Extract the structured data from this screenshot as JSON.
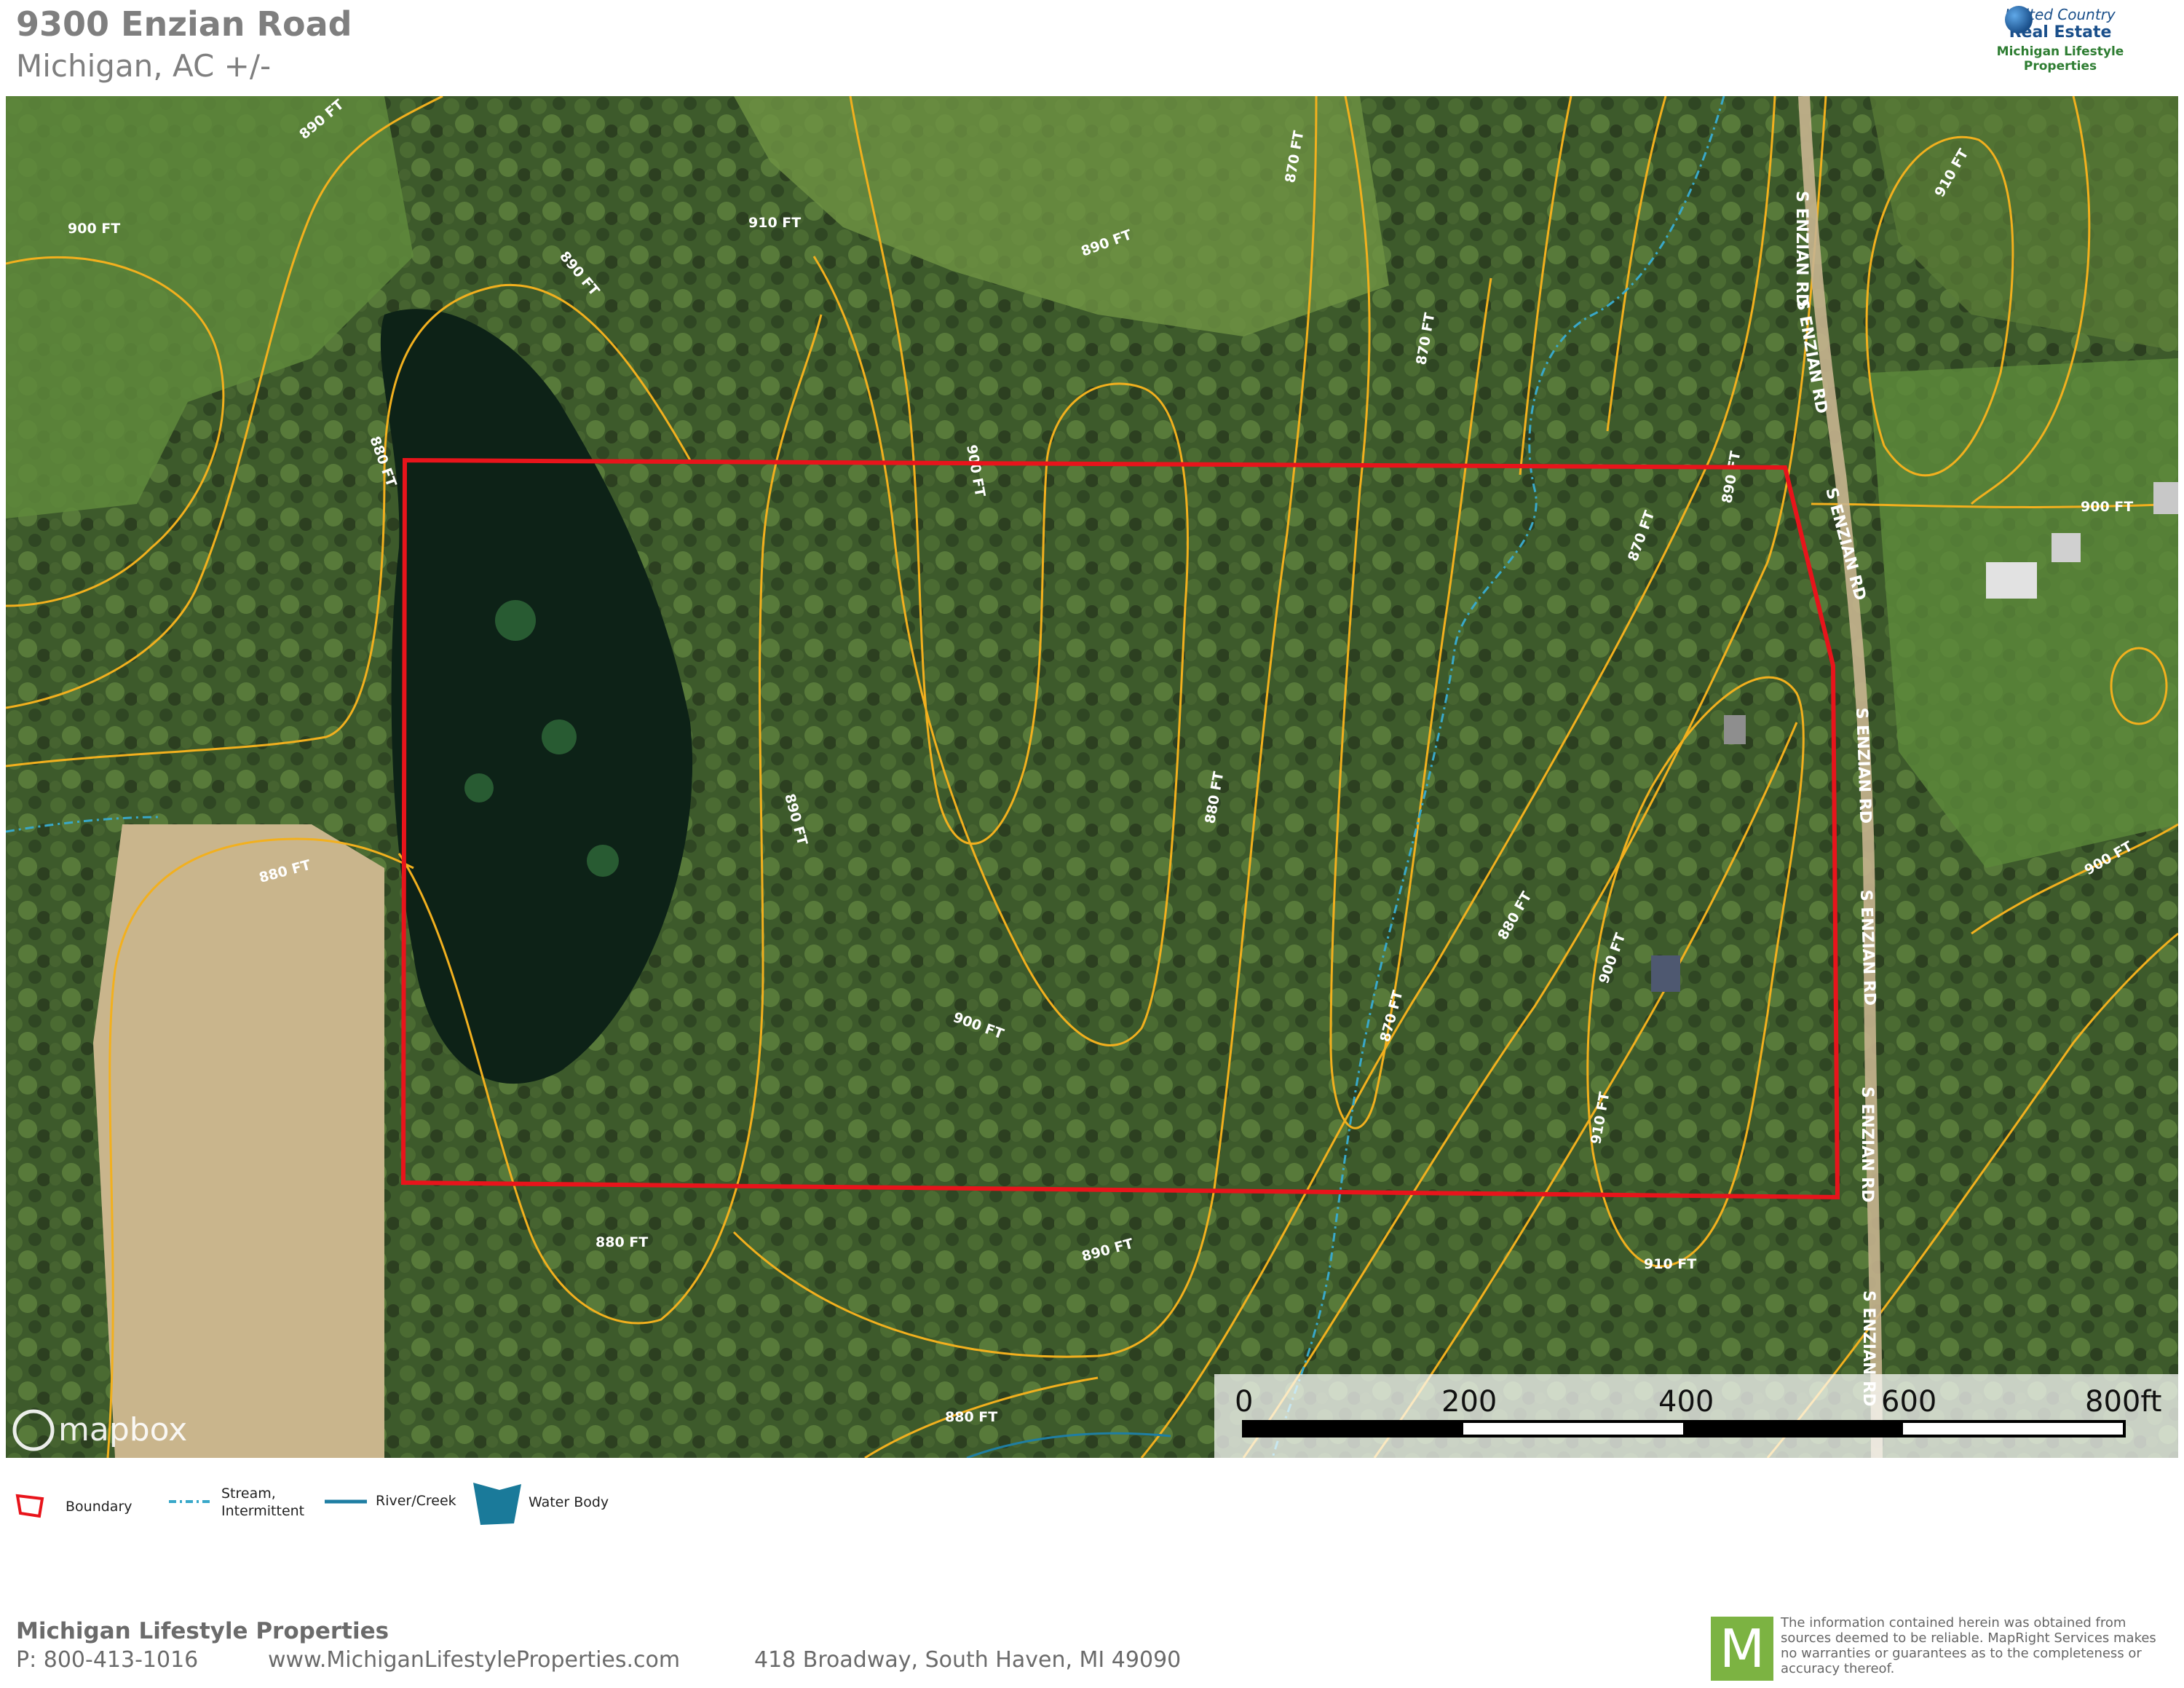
{
  "header": {
    "title": "9300 Enzian Road",
    "subtitle": "Michigan,  AC +/-"
  },
  "logo": {
    "line1": "United Country",
    "line2": "Real Estate",
    "line3": "Michigan Lifestyle Properties",
    "colors": {
      "blue": "#1a4f8a",
      "green": "#2e7d32"
    }
  },
  "map": {
    "attribution": "mapbox",
    "contour_labels": [
      "880 FT",
      "890 FT",
      "900 FT",
      "910 FT",
      "870 FT"
    ],
    "road_label": "S ENZIAN RD",
    "scale_ticks": [
      "0",
      "200",
      "400",
      "600",
      "800ft"
    ],
    "colors": {
      "boundary": "#e8141b",
      "contour": "#f2b01e",
      "stream": "#39a8c9",
      "forest": "#3f5a2c",
      "field": "#c8b48a",
      "pond": "#0c2016"
    }
  },
  "legend": {
    "boundary": "Boundary",
    "stream_line1": "Stream,",
    "stream_line2": "Intermittent",
    "river": "River/Creek",
    "water": "Water Body"
  },
  "footer": {
    "company": "Michigan Lifestyle Properties",
    "phone": "P: 800-413-1016",
    "website": "www.MichiganLifestyleProperties.com",
    "address": "418 Broadway, South Haven, MI  49090",
    "m_logo": "M",
    "disclaimer": "The information contained herein was obtained from sources deemed to be reliable.  MapRight Services makes no warranties or guarantees as to the completeness or accuracy thereof."
  }
}
